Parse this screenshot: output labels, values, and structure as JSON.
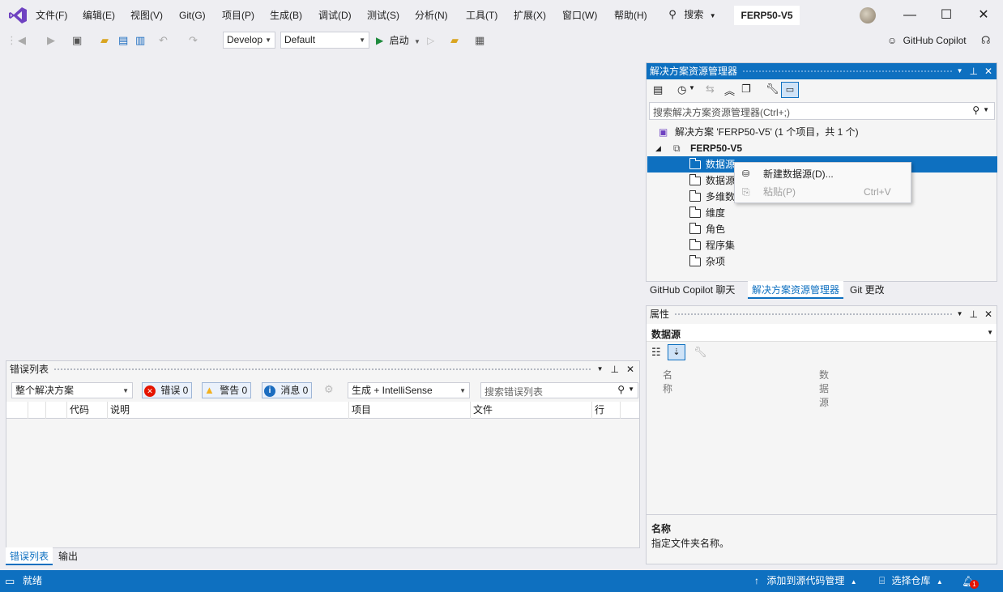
{
  "titlebar": {
    "menus": [
      "文件(F)",
      "编辑(E)",
      "视图(V)",
      "Git(G)",
      "项目(P)",
      "生成(B)",
      "调试(D)",
      "测试(S)",
      "分析(N)",
      "工具(T)",
      "扩展(X)",
      "窗口(W)",
      "帮助(H)"
    ],
    "search_label": "搜索",
    "project_name": "FERP50-V5"
  },
  "toolbar": {
    "config": "Develop",
    "platform": "Default",
    "start_label": "启动",
    "copilot_label": "GitHub Copilot"
  },
  "solution_explorer": {
    "title": "解决方案资源管理器",
    "search_placeholder": "搜索解决方案资源管理器(Ctrl+;)",
    "solution_label": "解决方案 'FERP50-V5' (1 个项目，共 1 个)",
    "project": "FERP50-V5",
    "folders": [
      "数据源",
      "数据源",
      "多维数",
      "维度",
      "角色",
      "程序集",
      "杂项"
    ],
    "tabs": [
      "GitHub Copilot 聊天",
      "解决方案资源管理器",
      "Git 更改"
    ]
  },
  "context_menu": {
    "items": [
      {
        "label": "新建数据源(D)...",
        "shortcut": ""
      },
      {
        "label": "粘贴(P)",
        "shortcut": "Ctrl+V"
      }
    ]
  },
  "error_list": {
    "title": "错误列表",
    "scope": "整个解决方案",
    "errors_label": "错误 0",
    "warnings_label": "警告 0",
    "messages_label": "消息 0",
    "source": "生成 + IntelliSense",
    "search_placeholder": "搜索错误列表",
    "columns": [
      "代码",
      "说明",
      "项目",
      "文件",
      "行"
    ],
    "tabs": [
      "错误列表",
      "输出"
    ]
  },
  "properties": {
    "title": "属性",
    "object": "数据源",
    "grid_name": "名称",
    "grid_value": "数据源",
    "desc_title": "名称",
    "desc_text": "指定文件夹名称。"
  },
  "statusbar": {
    "status": "就绪",
    "add_source": "添加到源代码管理",
    "select_repo": "选择仓库",
    "notifications": "1"
  },
  "colors": {
    "accent": "#0e70c0",
    "chrome": "#eeeef2",
    "vs_purple": "#6f42c1",
    "error_red": "#e51400",
    "warning_yellow": "#f2b01e"
  }
}
